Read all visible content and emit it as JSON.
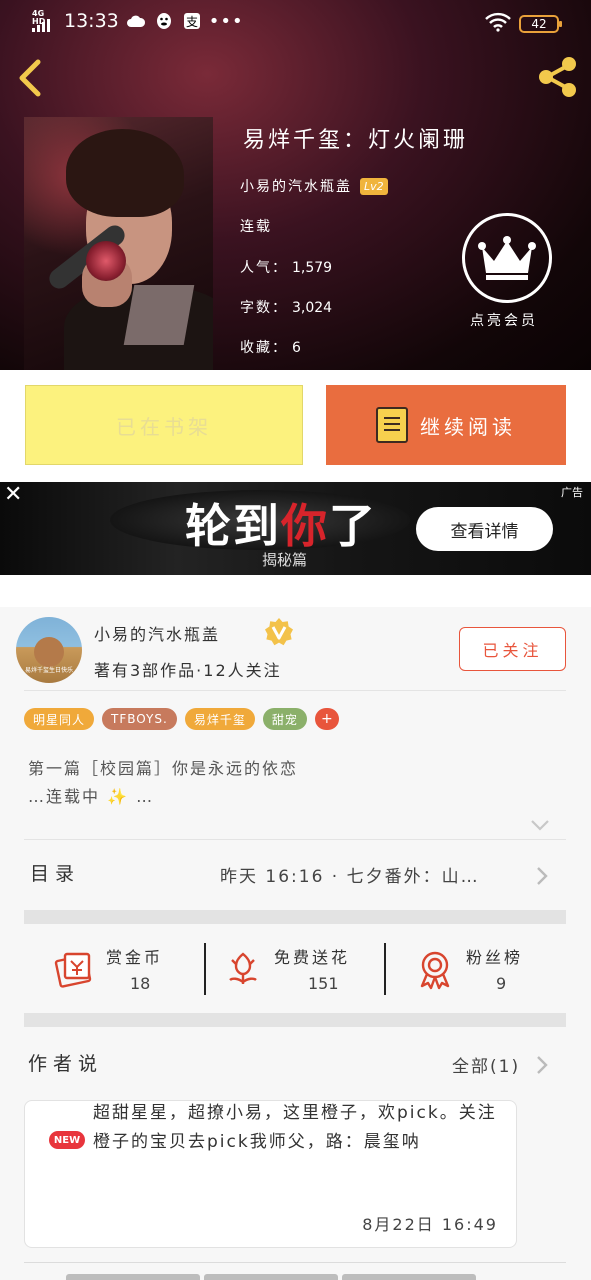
{
  "status_bar": {
    "network": "4G HD",
    "time": "13:33",
    "icons": [
      "cloud-icon",
      "penguin-icon",
      "alipay-icon",
      "more-dots-icon"
    ],
    "battery": "42"
  },
  "book": {
    "title": "易烊千玺：灯火阑珊",
    "author": "小易的汽水瓶盖",
    "level": "Lv2",
    "status": "连载",
    "popularity_label": "人气：",
    "popularity": "1,579",
    "words_label": "字数：",
    "words": "3,024",
    "favorites_label": "收藏：",
    "favorites": "6",
    "vip_label": "点亮会员"
  },
  "actions": {
    "shelf_label": "已在书架",
    "read_label": "继续阅读"
  },
  "ad": {
    "title_a": "轮到",
    "title_b": "你",
    "title_c": "了",
    "subtitle": "揭秘篇",
    "cta": "查看详情",
    "tag": "广告",
    "close": "✕"
  },
  "author_card": {
    "name": "小易的汽水瓶盖",
    "subtitle": "著有3部作品·12人关注",
    "follow_label": "已关注",
    "avatar_caption": "易烊千玺生日快乐",
    "tags": [
      {
        "label": "明星同人",
        "color": "#f0a93a"
      },
      {
        "label": "TFBOYS.",
        "color": "#c77a5d"
      },
      {
        "label": "易烊千玺",
        "color": "#f0a93a"
      },
      {
        "label": "甜宠",
        "color": "#8bb06a"
      }
    ],
    "tag_more": "+",
    "intro_line1": "第一篇［校园篇］你是永远的依恋",
    "intro_line2a": "…连载中",
    "intro_sparkle": "✨",
    "intro_line2b": "…"
  },
  "toc": {
    "label": "目录",
    "latest": "昨天 16:16 · 七夕番外：山…"
  },
  "stats": [
    {
      "icon": "red-envelope-icon",
      "label": "赏金币",
      "value": "18"
    },
    {
      "icon": "flower-icon",
      "label": "免费送花",
      "value": "151"
    },
    {
      "icon": "ribbon-medal-icon",
      "label": "粉丝榜",
      "value": "9"
    }
  ],
  "author_says": {
    "label": "作者说",
    "all_label": "全部(1)",
    "badge": "NEW",
    "text": "超甜星星，超撩小易，这里橙子，欢pick。关注橙子的宝贝去pick我师父，路：晨玺呐",
    "date": "8月22日   16:49"
  },
  "colors": {
    "accent": "#e8553c",
    "read_button": "#e96d3f",
    "shelf_button": "#fcf27e",
    "level_badge": "#f0b43c"
  }
}
